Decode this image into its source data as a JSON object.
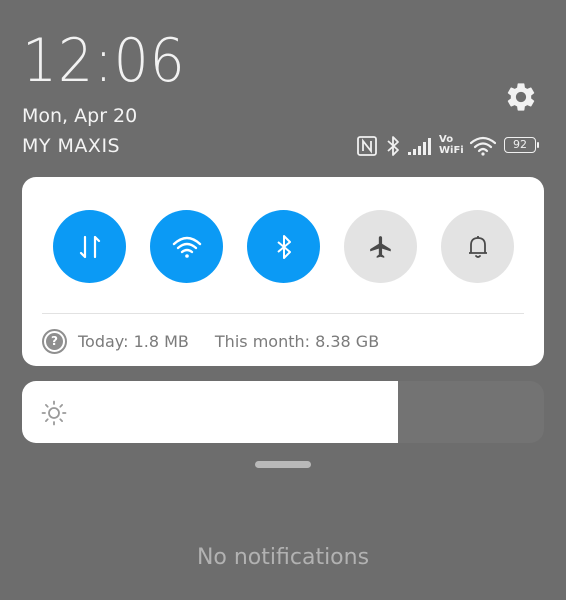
{
  "header": {
    "time": "12:06",
    "date": "Mon, Apr 20",
    "carrier": "MY MAXIS"
  },
  "status_bar": {
    "icons": [
      "nfc-icon",
      "bluetooth-icon",
      "signal-icon",
      "volte-icon",
      "wifi-icon",
      "battery-icon"
    ],
    "volte_top": "Vo",
    "volte_bottom": "WiFi",
    "battery": "92"
  },
  "toggles": [
    {
      "name": "mobile-data",
      "icon": "data-arrows-icon",
      "state": "on"
    },
    {
      "name": "wifi",
      "icon": "wifi-icon",
      "state": "on"
    },
    {
      "name": "bluetooth",
      "icon": "bluetooth-icon",
      "state": "on"
    },
    {
      "name": "airplane-mode",
      "icon": "airplane-icon",
      "state": "off"
    },
    {
      "name": "silent-mode",
      "icon": "bell-icon",
      "state": "off"
    }
  ],
  "data_usage": {
    "today": "Today: 1.8 MB",
    "month": "This month: 8.38 GB"
  },
  "brightness": {
    "level": 0.72,
    "icon": "sun-icon"
  },
  "notifications": {
    "empty_text": "No notifications"
  },
  "colors": {
    "background": "#6d6d6d",
    "accent": "#0b9af5",
    "toggle_off": "#e3e3e3"
  }
}
